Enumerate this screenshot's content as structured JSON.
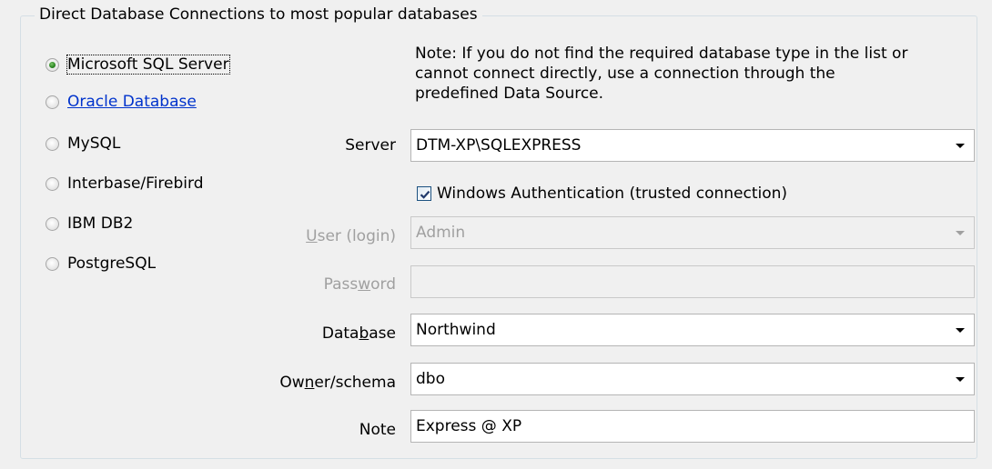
{
  "group": {
    "title": "Direct Database Connections to most popular databases"
  },
  "db_types": [
    {
      "label": "Microsoft SQL Server",
      "selected": true
    },
    {
      "label": "Oracle Database",
      "selected": false,
      "link": true
    },
    {
      "label": "MySQL",
      "selected": false
    },
    {
      "label": "Interbase/Firebird",
      "selected": false
    },
    {
      "label": "IBM DB2",
      "selected": false
    },
    {
      "label": "PostgreSQL",
      "selected": false
    }
  ],
  "note_text": "Note: If you do not find the required database type in the list or\ncannot connect directly, use a connection through the\npredefined Data Source.",
  "form": {
    "server": {
      "label": "Server",
      "value": "DTM-XP\\SQLEXPRESS"
    },
    "windows_auth": {
      "label": "Windows Authentication (trusted connection)",
      "checked": true
    },
    "user": {
      "label": "User (login)",
      "value": "Admin",
      "disabled": true
    },
    "password": {
      "label": "Password",
      "value": "",
      "disabled": true
    },
    "database": {
      "label": "Database",
      "value": "Northwind"
    },
    "owner": {
      "label": "Owner/schema",
      "value": "dbo"
    },
    "note": {
      "label": "Note",
      "value": "Express @ XP"
    }
  },
  "colors": {
    "link": "#0033cc",
    "disabled_text": "#a0a0a0",
    "background": "#f0f0f0"
  }
}
